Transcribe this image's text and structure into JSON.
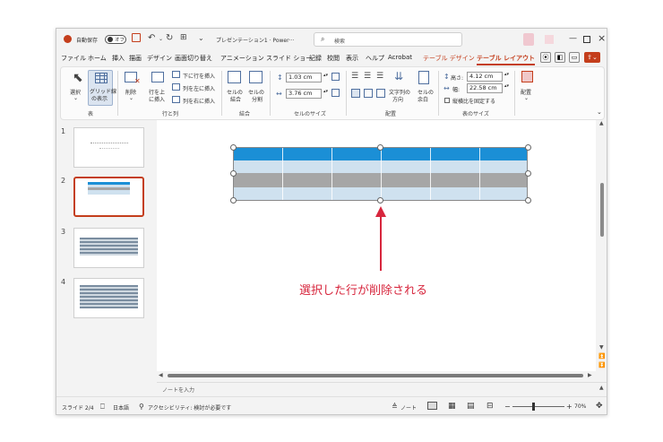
{
  "titlebar": {
    "autosave_label": "自動保存",
    "autosave_state": "オフ",
    "doc_title": "プレゼンテーション1 · Power···",
    "search_placeholder": "検索"
  },
  "menu": {
    "items": [
      "ファイル",
      "ホーム",
      "挿入",
      "描画",
      "デザイン",
      "画面切り替え",
      "アニメーション",
      "スライド ショー",
      "記録",
      "校閲",
      "表示",
      "ヘルプ",
      "Acrobat"
    ],
    "table_design": "テーブル デザイン",
    "table_layout": "テーブル レイアウト"
  },
  "ribbon": {
    "select": "選択",
    "gridlines_1": "グリッド線",
    "gridlines_2": "の表示",
    "group_table": "表",
    "delete": "削除",
    "insert_above_1": "行を上",
    "insert_above_2": "に挿入",
    "insert_below": "下に行を挿入",
    "insert_left": "列を左に挿入",
    "insert_right": "列を右に挿入",
    "group_rows_cols": "行と列",
    "merge_1": "セルの",
    "merge_2": "結合",
    "split_1": "セルの",
    "split_2": "分割",
    "group_merge": "結合",
    "cell_height": "1.03 cm",
    "cell_width": "3.76 cm",
    "group_cell_size": "セルのサイズ",
    "text_direction_1": "文字列の",
    "text_direction_2": "方向",
    "cell_margin_1": "セルの",
    "cell_margin_2": "余白",
    "group_alignment": "配置",
    "height_label": "高さ:",
    "height_value": "4.12 cm",
    "width_label": "幅:",
    "width_value": "22.58 cm",
    "lock_aspect": "縦横比を固定する",
    "group_table_size": "表のサイズ",
    "arrange": "配置"
  },
  "thumbnails": [
    {
      "number": "1"
    },
    {
      "number": "2"
    },
    {
      "number": "3"
    },
    {
      "number": "4"
    }
  ],
  "slide": {
    "annotation": "選択した行が削除される"
  },
  "notes_placeholder": "ノートを入力",
  "status": {
    "slide_info": "スライド 2/4",
    "language": "日本語",
    "accessibility": "アクセシビリティ: 検討が必要です",
    "notes_button": "ノート",
    "zoom": "70%"
  },
  "colors": {
    "accent": "#c43e1c",
    "header_row": "#1b8fd6",
    "light_row": "#cfe1ef",
    "deleted_row": "#a6a6a6",
    "annotation": "#d7263d"
  }
}
